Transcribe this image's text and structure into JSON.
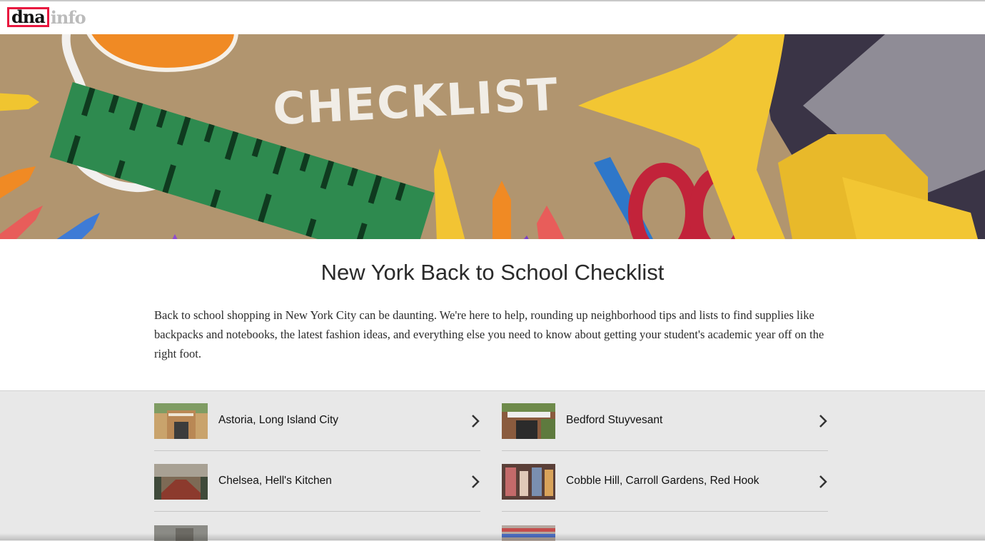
{
  "site": {
    "logo_primary": "dna",
    "logo_secondary": "info",
    "brand_color": "#e8173f"
  },
  "hero": {
    "banner_word": "CHECKLIST",
    "bg_color": "#b49873"
  },
  "page": {
    "title": "New York Back to School Checklist",
    "intro": "Back to school shopping in New York City can be daunting. We're here to help, rounding up neighborhood tips and lists to find supplies like backpacks and notebooks, the latest fashion ideas, and everything else you need to know about getting your student's academic year off on the right foot."
  },
  "neighborhoods": [
    {
      "label": "Astoria, Long Island City",
      "icon": "chevron-right-icon"
    },
    {
      "label": "Bedford Stuyvesant",
      "icon": "chevron-right-icon"
    },
    {
      "label": "Chelsea, Hell's Kitchen",
      "icon": "chevron-right-icon"
    },
    {
      "label": "Cobble Hill, Carroll Gardens, Red Hook",
      "icon": "chevron-right-icon"
    }
  ]
}
